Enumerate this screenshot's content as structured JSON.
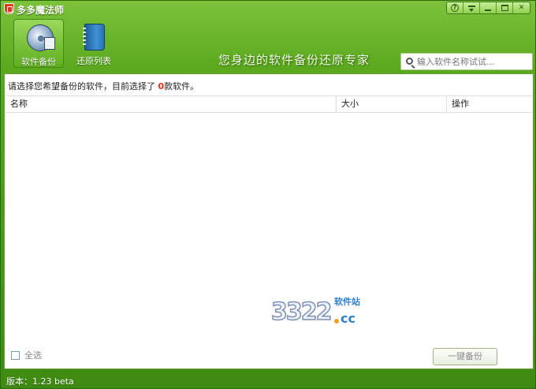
{
  "window": {
    "title": "多多魔法师"
  },
  "toolbar": {
    "tools": [
      {
        "label": "软件备份",
        "icon": "disk-backup-icon",
        "active": true
      },
      {
        "label": "还原列表",
        "icon": "notebook-icon",
        "active": false
      }
    ],
    "slogan": "您身边的软件备份还原专家"
  },
  "search": {
    "placeholder": "输入软件名称试试..."
  },
  "content": {
    "info_prefix": "请选择您希望备份的软件，目前选择了 ",
    "selected_count": "0",
    "info_suffix": "款软件。",
    "columns": [
      "名称",
      "大小",
      "操作"
    ],
    "rows": [],
    "select_all_label": "全选",
    "backup_button": "一键备份"
  },
  "watermark": {
    "number": "3322",
    "domain": "cc",
    "site": "软件站"
  },
  "status": {
    "version": "版本：1.23 beta"
  },
  "colors": {
    "frame_green": "#4a9a1a",
    "highlight_count": "#e0301e"
  }
}
